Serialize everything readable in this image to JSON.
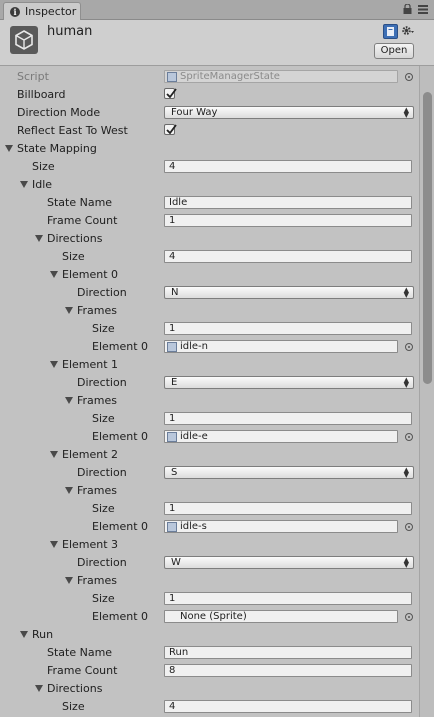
{
  "tab": {
    "title": "Inspector"
  },
  "header": {
    "object_name": "human",
    "open_label": "Open"
  },
  "rows": [
    {
      "type": "objectfield",
      "indent": 17,
      "label": "Script",
      "value": "SpriteManagerState",
      "disabled": true,
      "picker": true
    },
    {
      "type": "checkbox",
      "indent": 17,
      "label": "Billboard",
      "checked": true
    },
    {
      "type": "dropdown",
      "indent": 17,
      "label": "Direction Mode",
      "value": "Four Way"
    },
    {
      "type": "checkbox",
      "indent": 17,
      "label": "Reflect East To West",
      "checked": true
    },
    {
      "type": "foldout",
      "indent": 17,
      "label": "State Mapping"
    },
    {
      "type": "text",
      "indent": 32,
      "label": "Size",
      "value": "4"
    },
    {
      "type": "foldout",
      "indent": 32,
      "label": "Idle"
    },
    {
      "type": "text",
      "indent": 47,
      "label": "State Name",
      "value": "Idle"
    },
    {
      "type": "text",
      "indent": 47,
      "label": "Frame Count",
      "value": "1"
    },
    {
      "type": "foldout",
      "indent": 47,
      "label": "Directions"
    },
    {
      "type": "text",
      "indent": 62,
      "label": "Size",
      "value": "4"
    },
    {
      "type": "foldout",
      "indent": 62,
      "label": "Element 0"
    },
    {
      "type": "dropdown",
      "indent": 77,
      "label": "Direction",
      "value": "N"
    },
    {
      "type": "foldout",
      "indent": 77,
      "label": "Frames"
    },
    {
      "type": "text",
      "indent": 92,
      "label": "Size",
      "value": "1"
    },
    {
      "type": "objectfield",
      "indent": 92,
      "label": "Element 0",
      "value": "idle-n",
      "sprite": true,
      "picker": true
    },
    {
      "type": "foldout",
      "indent": 62,
      "label": "Element 1"
    },
    {
      "type": "dropdown",
      "indent": 77,
      "label": "Direction",
      "value": "E"
    },
    {
      "type": "foldout",
      "indent": 77,
      "label": "Frames"
    },
    {
      "type": "text",
      "indent": 92,
      "label": "Size",
      "value": "1"
    },
    {
      "type": "objectfield",
      "indent": 92,
      "label": "Element 0",
      "value": "idle-e",
      "sprite": true,
      "picker": true
    },
    {
      "type": "foldout",
      "indent": 62,
      "label": "Element 2"
    },
    {
      "type": "dropdown",
      "indent": 77,
      "label": "Direction",
      "value": "S"
    },
    {
      "type": "foldout",
      "indent": 77,
      "label": "Frames"
    },
    {
      "type": "text",
      "indent": 92,
      "label": "Size",
      "value": "1"
    },
    {
      "type": "objectfield",
      "indent": 92,
      "label": "Element 0",
      "value": "idle-s",
      "sprite": true,
      "picker": true
    },
    {
      "type": "foldout",
      "indent": 62,
      "label": "Element 3"
    },
    {
      "type": "dropdown",
      "indent": 77,
      "label": "Direction",
      "value": "W"
    },
    {
      "type": "foldout",
      "indent": 77,
      "label": "Frames"
    },
    {
      "type": "text",
      "indent": 92,
      "label": "Size",
      "value": "1"
    },
    {
      "type": "objectfield",
      "indent": 92,
      "label": "Element 0",
      "value": "None (Sprite)",
      "sprite": false,
      "picker": true
    },
    {
      "type": "foldout",
      "indent": 32,
      "label": "Run"
    },
    {
      "type": "text",
      "indent": 47,
      "label": "State Name",
      "value": "Run"
    },
    {
      "type": "text",
      "indent": 47,
      "label": "Frame Count",
      "value": "8"
    },
    {
      "type": "foldout",
      "indent": 47,
      "label": "Directions"
    },
    {
      "type": "text",
      "indent": 62,
      "label": "Size",
      "value": "4"
    }
  ]
}
